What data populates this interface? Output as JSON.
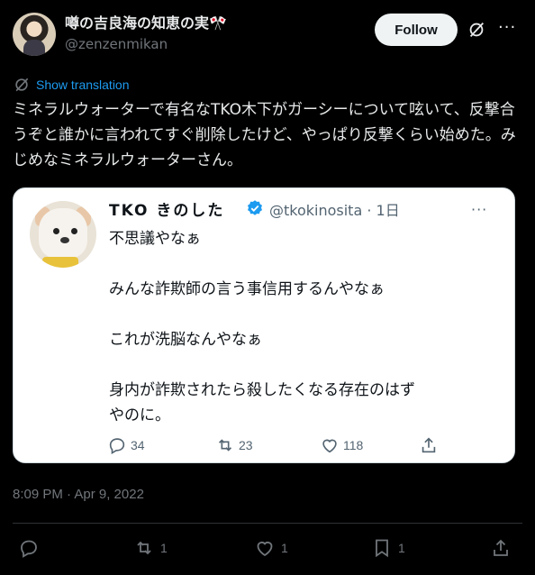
{
  "author": {
    "display_name": "噂の吉良海の知恵の実🎌",
    "handle": "@zenzenmikan"
  },
  "header": {
    "follow_label": "Follow"
  },
  "translation": {
    "label": "Show translation"
  },
  "tweet": {
    "text": "ミネラルウォーターで有名なTKO木下がガーシーについて呟いて、反撃合うぞと誰かに言われてすぐ削除したけど、やっぱり反撃くらい始めた。みじめなミネラルウォーターさん。",
    "timestamp": "8:09 PM · Apr 9, 2022"
  },
  "quote": {
    "name": "TKO きのした",
    "handle_time": "@tkokinosita · 1日",
    "lines": [
      "不思議やなぁ",
      "",
      "みんな詐欺師の言う事信用するんやなぁ",
      "",
      "これが洗脳なんやなぁ",
      "",
      "身内が詐欺されたら殺したくなる存在のはず",
      "やのに。"
    ],
    "replies": "34",
    "retweets": "23",
    "likes": "118"
  },
  "actions": {
    "retweets": "1",
    "likes": "1",
    "bookmarks": "1"
  },
  "colors": {
    "background": "#000000",
    "accent": "#1d9bf0",
    "muted": "#71767b",
    "verified": "#1d9bf0"
  }
}
